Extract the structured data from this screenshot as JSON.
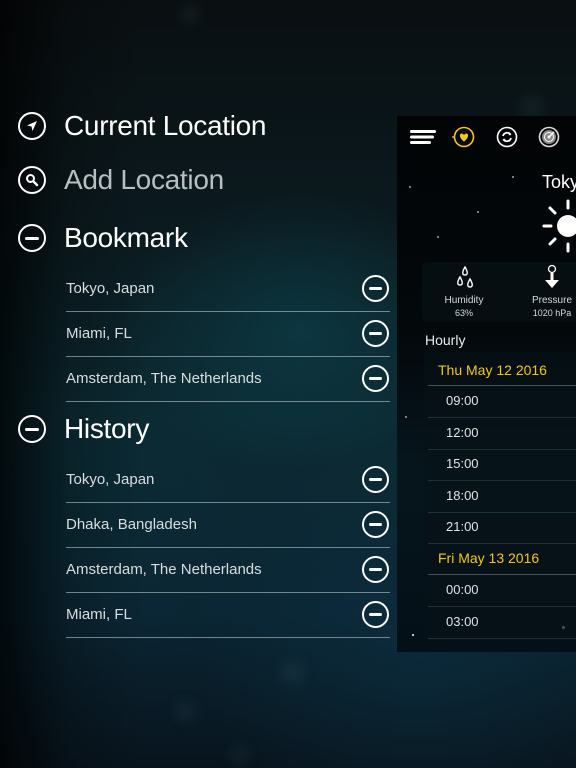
{
  "menu": {
    "current_location": {
      "label": "Current Location",
      "icon": "location-arrow-icon"
    },
    "add_location": {
      "label": "Add Location",
      "icon": "search-icon"
    },
    "bookmark": {
      "label": "Bookmark",
      "icon": "minus-circle-icon",
      "items": [
        {
          "label": "Tokyo, Japan"
        },
        {
          "label": "Miami, FL"
        },
        {
          "label": "Amsterdam, The Netherlands"
        }
      ]
    },
    "history": {
      "label": "History",
      "icon": "minus-circle-icon",
      "items": [
        {
          "label": "Tokyo, Japan"
        },
        {
          "label": "Dhaka, Bangladesh"
        },
        {
          "label": "Amsterdam, The Netherlands"
        },
        {
          "label": "Miami, FL"
        }
      ]
    }
  },
  "panel": {
    "toolbar": [
      "menu-icon",
      "heart-icon",
      "refresh-icon",
      "radar-icon"
    ],
    "city": "Tokyo",
    "condition_icon": "sun-icon",
    "stats": [
      {
        "name": "Humidity",
        "value": "63%",
        "icon": "droplets-icon"
      },
      {
        "name": "Pressure",
        "value": "1020 hPa",
        "icon": "pressure-gauge-icon"
      }
    ],
    "hourly_title": "Hourly",
    "days": [
      {
        "date": "Thu May 12 2016",
        "hours": [
          "09:00",
          "12:00",
          "15:00",
          "18:00",
          "21:00"
        ]
      },
      {
        "date": "Fri May 13 2016",
        "hours": [
          "00:00",
          "03:00"
        ]
      }
    ]
  },
  "colors": {
    "accent_yellow": "#f2c81e",
    "text_primary": "#ffffff",
    "text_dim": "#b8bec2"
  }
}
